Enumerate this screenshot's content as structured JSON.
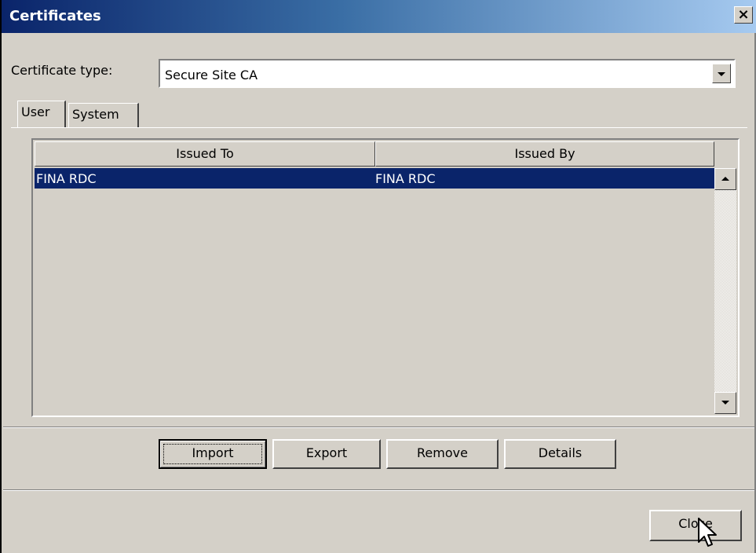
{
  "window": {
    "title": "Certificates",
    "close_glyph": "×",
    "close_icon": "close-icon"
  },
  "certificate_type": {
    "label": "Certificate type:",
    "selected": "Secure Site CA",
    "dropdown_icon": "chevron-down-icon"
  },
  "tabs": [
    {
      "label": "User",
      "active": true
    },
    {
      "label": "System",
      "active": false
    }
  ],
  "table": {
    "columns": [
      "Issued To",
      "Issued By"
    ],
    "rows": [
      {
        "issued_to": "FINA RDC",
        "issued_by": "FINA RDC",
        "selected": true
      }
    ],
    "selection_color": "#0a246a"
  },
  "actions": {
    "import": "Import",
    "export": "Export",
    "remove": "Remove",
    "details": "Details"
  },
  "footer": {
    "close": "Close"
  },
  "colors": {
    "face": "#d4d0c8",
    "title_start": "#0a246a",
    "title_end": "#a6caf0"
  }
}
